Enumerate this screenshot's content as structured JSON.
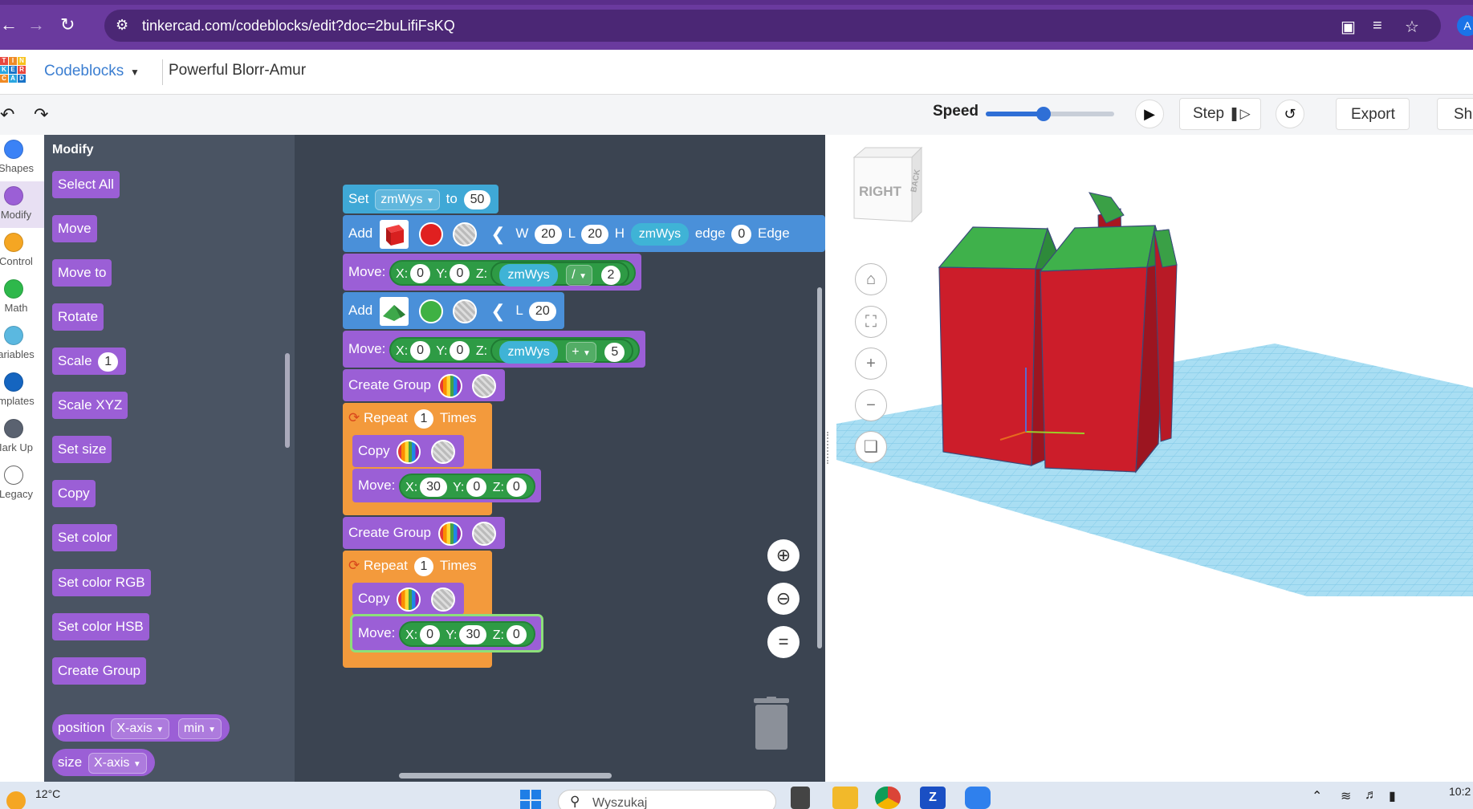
{
  "browser": {
    "url": "tinkercad.com/codeblocks/edit?doc=2buLifiFsKQ",
    "profile_initial": "A"
  },
  "app": {
    "logo_letters": [
      "T",
      "I",
      "N",
      "K",
      "E",
      "R",
      "C",
      "A",
      "D"
    ],
    "mode_label": "Codeblocks",
    "project_name": "Powerful Blorr-Amur"
  },
  "toolbar": {
    "speed_label": "Speed",
    "speed_value": 0.45,
    "step_label": "Step",
    "export_label": "Export",
    "share_label": "Sha"
  },
  "categories": [
    {
      "label": "Shapes",
      "color": "#3b82f6",
      "active": false
    },
    {
      "label": "Modify",
      "color": "#9b5fd6",
      "active": true
    },
    {
      "label": "Control",
      "color": "#f5a623",
      "active": false
    },
    {
      "label": "Math",
      "color": "#2eb84b",
      "active": false
    },
    {
      "label": "ariables",
      "color": "#5bb8e0",
      "active": false
    },
    {
      "label": "mplates",
      "color": "#1565c0",
      "active": false
    },
    {
      "label": "Iark Up",
      "color": "#5a6270",
      "active": false
    },
    {
      "label": "Legacy",
      "color": "#ffffff",
      "active": false
    }
  ],
  "flyout": {
    "title": "Modify",
    "blocks": [
      {
        "label": "Select All"
      },
      {
        "label": "Move"
      },
      {
        "label": "Move to"
      },
      {
        "label": "Rotate"
      },
      {
        "label": "Scale",
        "value": "1"
      },
      {
        "label": "Scale XYZ"
      },
      {
        "label": "Set size"
      },
      {
        "label": "Copy"
      },
      {
        "label": "Set color"
      },
      {
        "label": "Set color RGB"
      },
      {
        "label": "Set color HSB"
      },
      {
        "label": "Create Group"
      }
    ],
    "position_block": {
      "label": "position",
      "axis": "X-axis",
      "mode": "min"
    },
    "size_block": {
      "label": "size",
      "axis": "X-axis"
    }
  },
  "workspace": {
    "set": {
      "label": "Set",
      "var": "zmWys",
      "to": "to",
      "value": "50"
    },
    "add1": {
      "label": "Add",
      "w_label": "W",
      "w": "20",
      "l_label": "L",
      "l": "20",
      "h_label": "H",
      "h_var": "zmWys",
      "edge_label": "edge",
      "edge": "0",
      "edge2_label": "Edge"
    },
    "move1": {
      "label": "Move:",
      "x_label": "X:",
      "x": "0",
      "y_label": "Y:",
      "y": "0",
      "z_label": "Z:",
      "z_var": "zmWys",
      "op": "/",
      "operand": "2"
    },
    "add2": {
      "label": "Add",
      "l_label": "L",
      "l": "20"
    },
    "move2": {
      "label": "Move:",
      "x_label": "X:",
      "x": "0",
      "y_label": "Y:",
      "y": "0",
      "z_label": "Z:",
      "z_var": "zmWys",
      "op": "+",
      "operand": "5"
    },
    "group1": {
      "label": "Create Group"
    },
    "repeat1": {
      "label": "Repeat",
      "count": "1",
      "times": "Times"
    },
    "copy1": {
      "label": "Copy"
    },
    "move3": {
      "label": "Move:",
      "x_label": "X:",
      "x": "30",
      "y_label": "Y:",
      "y": "0",
      "z_label": "Z:",
      "z": "0"
    },
    "group2": {
      "label": "Create Group"
    },
    "repeat2": {
      "label": "Repeat",
      "count": "1",
      "times": "Times"
    },
    "copy2": {
      "label": "Copy"
    },
    "move4": {
      "label": "Move:",
      "x_label": "X:",
      "x": "0",
      "y_label": "Y:",
      "y": "30",
      "z_label": "Z:",
      "z": "0"
    }
  },
  "viewport": {
    "viewcube_label": "RIGHT",
    "viewcube_side": "BACK"
  },
  "taskbar": {
    "temperature": "12°C",
    "search_placeholder": "Wyszukaj",
    "clock": "10:2"
  },
  "icons": {
    "back": "arrow-left-icon",
    "forward": "arrow-right-icon",
    "reload": "reload-icon",
    "star": "star-icon",
    "translate": "translate-icon",
    "install": "install-app-icon",
    "play": "play-icon",
    "reset": "reset-icon",
    "zoom_in": "zoom-in-icon",
    "zoom_out": "zoom-out-icon",
    "zoom_reset": "zoom-reset-icon",
    "trash": "trash-icon"
  }
}
